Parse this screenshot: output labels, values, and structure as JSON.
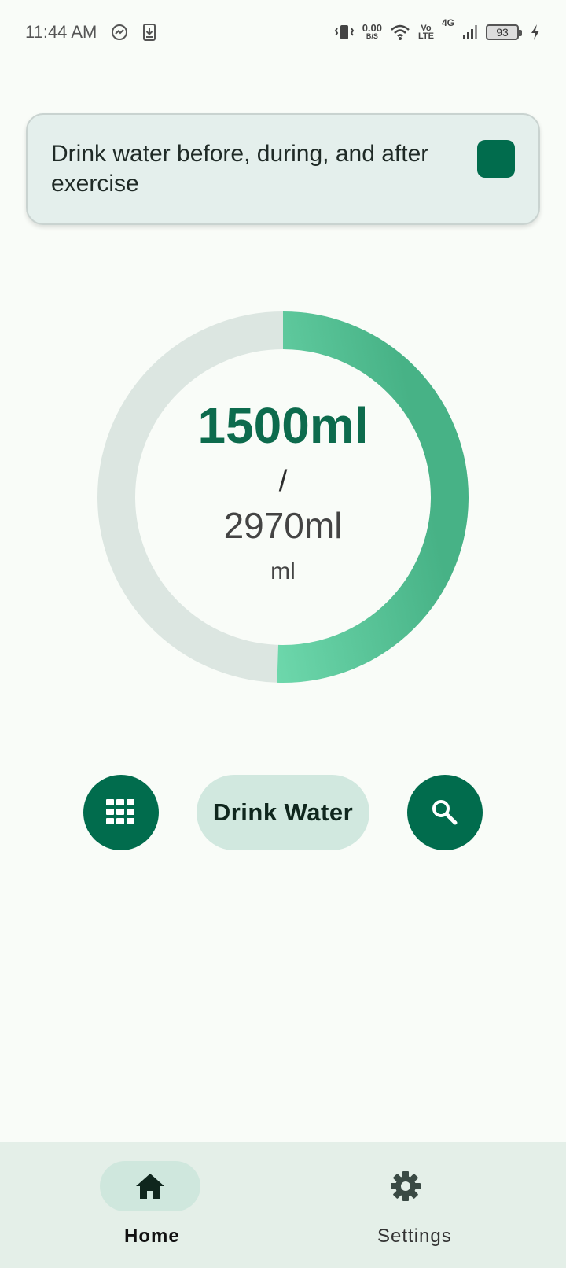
{
  "status_bar": {
    "time": "11:44 AM",
    "net_speed_value": "0.00",
    "net_speed_unit": "B/S",
    "volte_top": "Vo",
    "volte_bottom": "LTE",
    "network": "4G",
    "battery": "93"
  },
  "tip": {
    "text": "Drink water before, during, and after exercise",
    "checked": true
  },
  "progress": {
    "consumed": "1500ml",
    "separator": "/",
    "goal": "2970ml",
    "unit": "ml",
    "fraction": 0.505,
    "colors": {
      "track": "#dce6e1",
      "fill_start": "#8df7cb",
      "fill_end": "#47b286"
    }
  },
  "actions": {
    "grid_icon": "grid-icon",
    "drink_label": "Drink Water",
    "search_icon": "search-icon",
    "accent": "#016c4d"
  },
  "nav": {
    "home_label": "Home",
    "settings_label": "Settings",
    "selected": "home"
  }
}
